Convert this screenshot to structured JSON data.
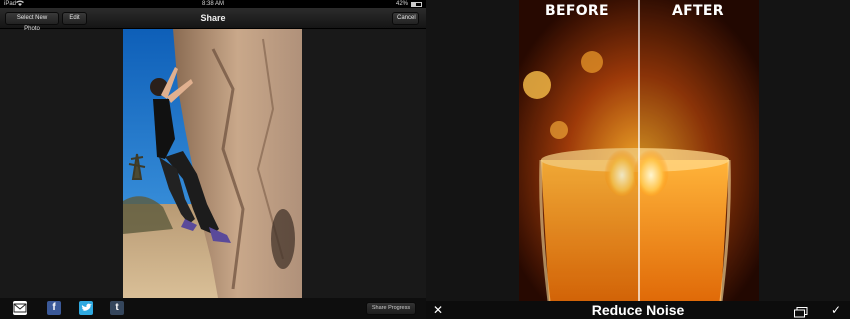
{
  "status_bar": {
    "carrier": "iPad",
    "time": "8:38 AM",
    "battery": "42%"
  },
  "nav": {
    "select_new_photo": "Select New Photo",
    "edit": "Edit",
    "title": "Share",
    "cancel": "Cancel"
  },
  "share_bar": {
    "icons": [
      "mail-icon",
      "facebook-icon",
      "twitter-icon",
      "tumblr-icon"
    ],
    "facebook_glyph": "f",
    "tumblr_glyph": "t",
    "share_progress": "Share Progress"
  },
  "compare": {
    "before_label": "BEFORE",
    "after_label": "AFTER"
  },
  "bottom_toolbar": {
    "title": "Reduce Noise"
  },
  "colors": {
    "facebook": "#3b5998",
    "twitter": "#2fa9e0",
    "tumblr": "#35465c"
  }
}
